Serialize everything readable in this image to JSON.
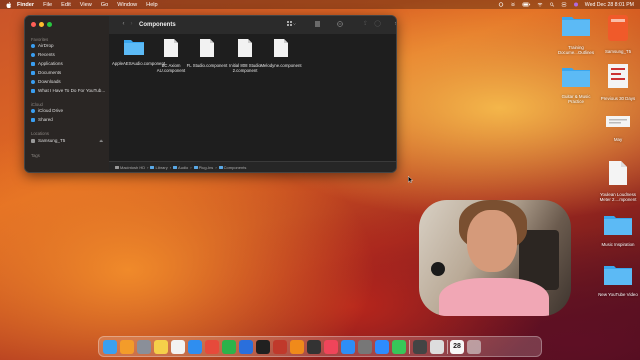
{
  "menubar": {
    "app": "Finder",
    "items": [
      "File",
      "Edit",
      "View",
      "Go",
      "Window",
      "Help"
    ],
    "clock": "Wed Dec 28  8:01 PM"
  },
  "finder": {
    "title": "Components",
    "sidebar": {
      "favorites_heading": "Favorites",
      "favorites": [
        "AirDrop",
        "Recents",
        "Applications",
        "Documents",
        "Downloads",
        "What I Have To Do For YouTub..."
      ],
      "icloud_heading": "iCloud",
      "icloud": [
        "iCloud Drive",
        "Shared"
      ],
      "locations_heading": "Locations",
      "locations": [
        "Samsung_T5"
      ],
      "tags_heading": "Tags"
    },
    "files": [
      {
        "name": "AppleAESAudio.component",
        "kind": "folder"
      },
      {
        "name": "BC Axiom AU.component",
        "kind": "doc"
      },
      {
        "name": "FL Studio.component",
        "kind": "doc"
      },
      {
        "name": "Initial 808 Studio 2.component",
        "kind": "doc"
      },
      {
        "name": "Melodyne.component",
        "kind": "doc"
      }
    ],
    "path": [
      "Macintosh HD",
      "Library",
      "Audio",
      "Plug-Ins",
      "Components"
    ]
  },
  "desktop": [
    {
      "name": "",
      "kind": "folder"
    },
    {
      "name": "Samsung_T5",
      "kind": "drive"
    },
    {
      "name": "Training Docume...Outlines",
      "kind": "folder"
    },
    {
      "name": "Previous 30 Days",
      "kind": "image"
    },
    {
      "name": "Guitar & Music Practice",
      "kind": "folder"
    },
    {
      "name": "",
      "kind": "doc"
    },
    {
      "name": "May",
      "kind": "doc"
    },
    {
      "name": "Youlean Loudness Meter 2....mponent",
      "kind": "doc"
    },
    {
      "name": "Music Inspiration",
      "kind": "folder"
    },
    {
      "name": "New YouTube Video",
      "kind": "folder"
    }
  ],
  "dock": {
    "apps": [
      {
        "name": "Finder",
        "color": "#3aa0f0"
      },
      {
        "name": "Pages",
        "color": "#f39c2a"
      },
      {
        "name": "Launchpad",
        "color": "#8a8f99"
      },
      {
        "name": "Notes",
        "color": "#f5d04a"
      },
      {
        "name": "Calendar",
        "color": "#f2f2f2"
      },
      {
        "name": "Safari",
        "color": "#2f8ef0"
      },
      {
        "name": "Chrome",
        "color": "#e64a3b"
      },
      {
        "name": "Numbers",
        "color": "#2db34a"
      },
      {
        "name": "Keynote",
        "color": "#2a6fdc"
      },
      {
        "name": "Stocks",
        "color": "#202020"
      },
      {
        "name": "Photo Booth",
        "color": "#c0392b"
      },
      {
        "name": "FL Studio",
        "color": "#f08a1a"
      },
      {
        "name": "Logic",
        "color": "#333"
      },
      {
        "name": "Music",
        "color": "#f0455a"
      },
      {
        "name": "App Store",
        "color": "#2e8ef5"
      },
      {
        "name": "Settings",
        "color": "#777"
      },
      {
        "name": "Zoom",
        "color": "#2d8cff"
      },
      {
        "name": "Messages",
        "color": "#38c759"
      },
      {
        "name": "Calculator",
        "color": "#444"
      },
      {
        "name": "Preview",
        "color": "#ddd"
      },
      {
        "name": "Calendar Date",
        "color": "#f7f7f7"
      }
    ],
    "calendar_day": "28"
  }
}
